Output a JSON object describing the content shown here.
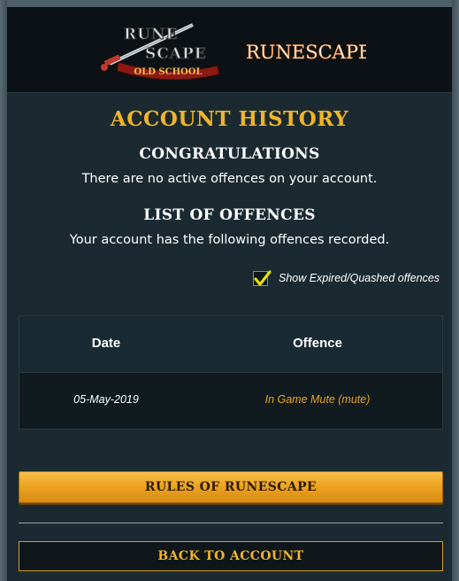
{
  "brand": {
    "osrs_logo_top": "RUNE",
    "osrs_logo_mid": "SCAPE",
    "osrs_logo_banner": "OLD SCHOOL",
    "rs_logo": "RUNESCAPE"
  },
  "page": {
    "title": "ACCOUNT HISTORY",
    "congrats_heading": "CONGRATULATIONS",
    "congrats_text": "There are no active offences on your account.",
    "list_heading": "LIST OF OFFENCES",
    "list_text": "Your account has the following offences recorded."
  },
  "filter": {
    "show_expired_label": "Show Expired/Quashed offences",
    "show_expired_checked": true
  },
  "table": {
    "columns": [
      "Date",
      "Offence"
    ],
    "rows": [
      {
        "date": "05-May-2019",
        "offence": "In Game Mute (mute)"
      }
    ]
  },
  "actions": {
    "rules_label": "RULES OF RUNESCAPE",
    "back_label": "BACK TO ACCOUNT"
  },
  "colors": {
    "accent_gold": "#f0b429",
    "offence_text": "#e6a521",
    "panel_bg": "#1b2a31"
  }
}
